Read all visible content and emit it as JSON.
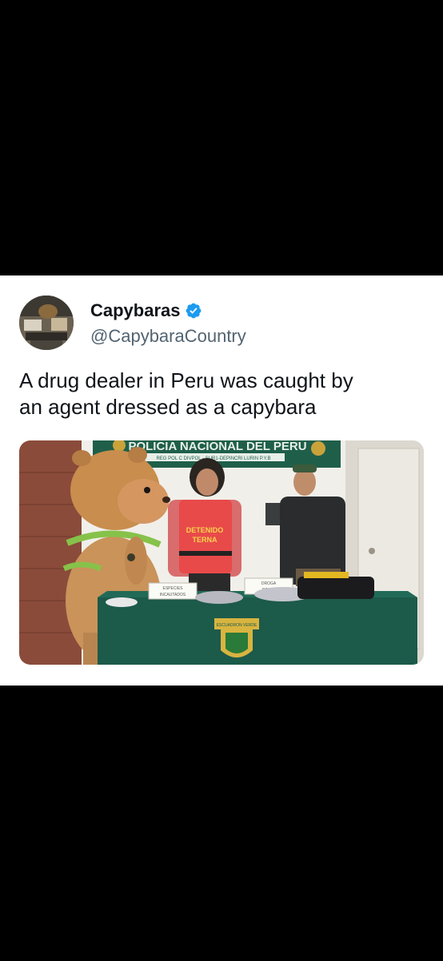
{
  "tweet": {
    "display_name": "Capybaras",
    "handle": "@CapybaraCountry",
    "verified_icon": "verified-badge-icon",
    "text_lines": [
      "A drug dealer in Peru was caught by",
      "an agent dressed as a capybara"
    ]
  },
  "photo": {
    "banner_text": "POLICIA NACIONAL DEL PERU",
    "banner_sub": "REG POL C DIVPOL - SUR1-DEPINCRI LURIN P.Y.B",
    "vest_text": [
      "DETENIDO",
      "TERNA"
    ],
    "sign_left": [
      "ESPECIES",
      "INCAUTADOS"
    ],
    "sign_right": [
      "DROGA",
      "COMIS"
    ],
    "tablecloth_crest": "ESCUADRON VERDE"
  },
  "colors": {
    "brand_blue": "#1d9bf0",
    "background": "#000000",
    "card": "#ffffff",
    "text": "#0f1419",
    "secondary_text": "#536471"
  }
}
